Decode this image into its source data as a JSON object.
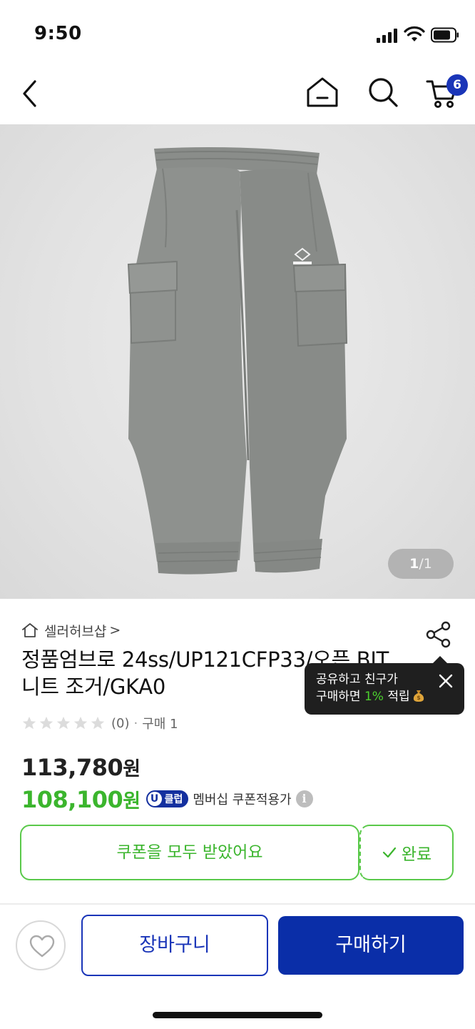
{
  "status_bar": {
    "time": "9:50"
  },
  "header": {
    "cart_count": "6"
  },
  "image": {
    "current": "1",
    "total": "/1"
  },
  "seller": {
    "name": "셀러허브샵",
    "chevron": ">"
  },
  "product": {
    "title": "정품엄브로 24ss/UP121CFP33/오픈 BIT 니트 조거/GKA0",
    "review_count": "(0)",
    "separator": "·",
    "purchase_count": "구매 1",
    "rating_stars": 0
  },
  "tooltip": {
    "line1": "공유하고 친구가",
    "line2_prefix": "구매하면 ",
    "line2_highlight": "1%",
    "line2_suffix": " 적립"
  },
  "price": {
    "original": "113,780",
    "original_unit": "원",
    "sale": "108,100",
    "sale_unit": "원",
    "uclub_u": "U",
    "uclub_label": "클럽",
    "membership_text": "멤버십 쿠폰적용가",
    "info_glyph": "i"
  },
  "coupon": {
    "status_label": "쿠폰을 모두 받았어요",
    "done_label": "완료"
  },
  "actions": {
    "cart_label": "장바구니",
    "buy_label": "구매하기"
  },
  "colors": {
    "brand_blue": "#1a35b8",
    "sale_green": "#3bb52d"
  }
}
